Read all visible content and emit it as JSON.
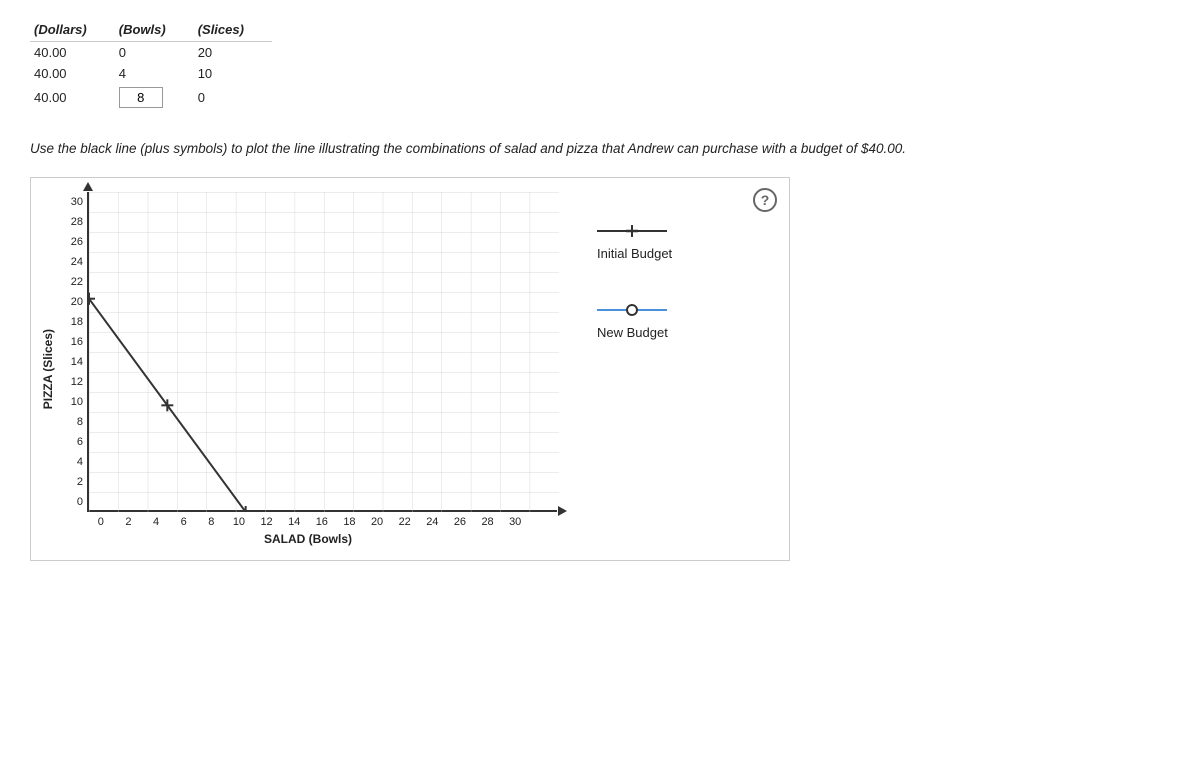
{
  "table": {
    "headers": [
      "(Dollars)",
      "(Bowls)",
      "(Slices)"
    ],
    "rows": [
      {
        "dollars": "40.00",
        "bowls": "0",
        "slices": "20"
      },
      {
        "dollars": "40.00",
        "bowls": "4",
        "slices": "10"
      },
      {
        "dollars": "40.00",
        "bowls_input": "8",
        "slices": "0"
      }
    ]
  },
  "instruction": "Use the black line (plus symbols) to plot the line illustrating the combinations of salad and pizza that Andrew can purchase with a budget of $40.00.",
  "chart": {
    "y_axis_label": "PIZZA (Slices)",
    "x_axis_label": "SALAD (Bowls)",
    "x_ticks": [
      "0",
      "2",
      "4",
      "6",
      "8",
      "10",
      "12",
      "14",
      "16",
      "18",
      "20",
      "22",
      "24",
      "26",
      "28",
      "30"
    ],
    "y_ticks": [
      "0",
      "2",
      "4",
      "6",
      "8",
      "10",
      "12",
      "14",
      "16",
      "18",
      "20",
      "22",
      "24",
      "26",
      "28",
      "30"
    ],
    "help_tooltip": "?"
  },
  "legend": {
    "initial_budget_label": "Initial Budget",
    "new_budget_label": "New Budget"
  }
}
